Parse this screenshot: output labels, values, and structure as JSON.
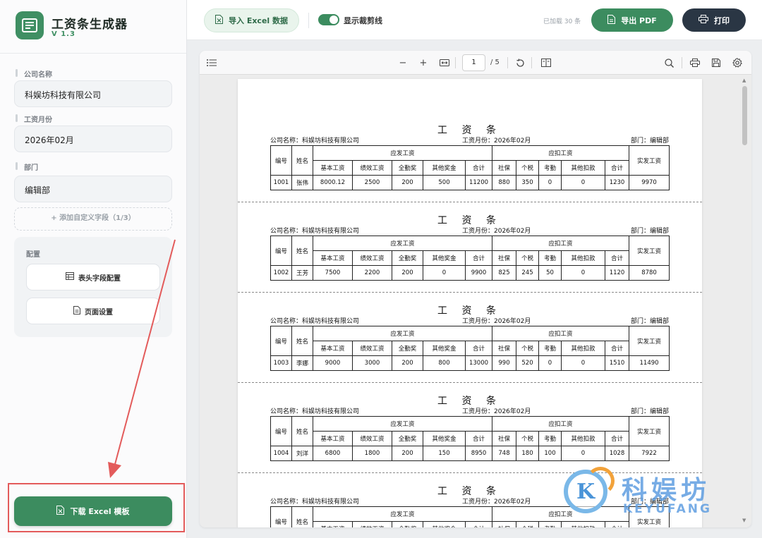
{
  "app": {
    "title": "工资条生成器",
    "version": "V 1.3"
  },
  "sidebar": {
    "company_label": "公司名称",
    "company_value": "科娱坊科技有限公司",
    "month_label": "工资月份",
    "month_value": "2026年02月",
    "dept_label": "部门",
    "dept_value": "编辑部",
    "add_field_label": "+ 添加自定义字段（1/3）",
    "config_title": "配置",
    "header_config_label": "表头字段配置",
    "page_setup_label": "页面设置",
    "download_label": "下载 Excel 模板"
  },
  "topbar": {
    "import_label": "导入 Excel 数据",
    "toggle_label": "显示裁剪线",
    "loaded_count": "已加载 30 条",
    "export_label": "导出 PDF",
    "print_label": "打印"
  },
  "pdf_toolbar": {
    "current_page": "1",
    "total_pages": "/ 5",
    "zoom_out_glyph": "−",
    "zoom_in_glyph": "+"
  },
  "slip_common": {
    "title": "工 资 条",
    "company_text": "公司名称：科娱坊科技有限公司",
    "month_text": "工资月份：2026年02月",
    "dept_text": "部门：编辑部",
    "h_id": "编号",
    "h_name": "姓名",
    "h_payable": "应发工资",
    "h_deduct": "应扣工资",
    "h_net": "实发工资",
    "sub_headers": [
      "基本工资",
      "绩效工资",
      "全勤奖",
      "其他奖金",
      "合计",
      "社保",
      "个税",
      "考勤",
      "其他扣款",
      "合计"
    ]
  },
  "slips": [
    {
      "values": [
        "1001",
        "张伟",
        "8000.12",
        "2500",
        "200",
        "500",
        "11200",
        "880",
        "350",
        "0",
        "0",
        "1230",
        "9970"
      ]
    },
    {
      "values": [
        "1002",
        "王芳",
        "7500",
        "2200",
        "200",
        "0",
        "9900",
        "825",
        "245",
        "50",
        "0",
        "1120",
        "8780"
      ]
    },
    {
      "values": [
        "1003",
        "李娜",
        "9000",
        "3000",
        "200",
        "800",
        "13000",
        "990",
        "520",
        "0",
        "0",
        "1510",
        "11490"
      ]
    },
    {
      "values": [
        "1004",
        "刘洋",
        "6800",
        "1800",
        "200",
        "150",
        "8950",
        "748",
        "180",
        "100",
        "0",
        "1028",
        "7922"
      ]
    },
    {
      "values": []
    }
  ],
  "watermark": {
    "cn": "科娱坊",
    "en": "KEYUFANG",
    "letter": "K"
  },
  "colors": {
    "accent": "#3c8c5f",
    "dark_button": "#2a3644",
    "annotation_red": "#e35b5b"
  }
}
